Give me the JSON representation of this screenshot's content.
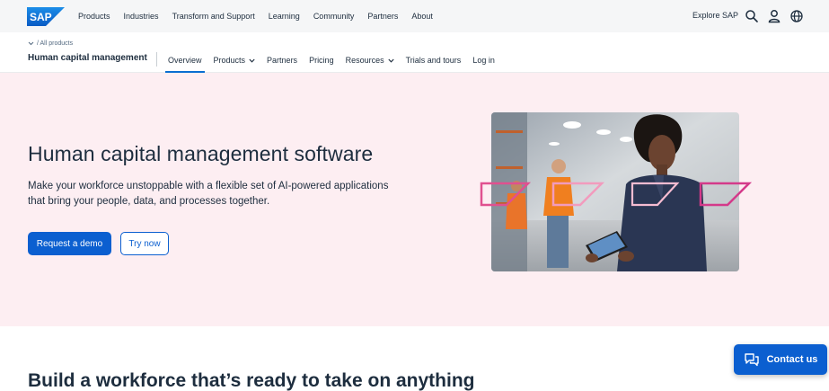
{
  "header": {
    "logo_text": "SAP",
    "nav": [
      "Products",
      "Industries",
      "Transform and Support",
      "Learning",
      "Community",
      "Partners",
      "About"
    ],
    "explore_label": "Explore SAP",
    "icons": [
      "search-icon",
      "user-icon",
      "globe-icon"
    ]
  },
  "subnav": {
    "breadcrumb": "/ All products",
    "section_title": "Human capital management",
    "items": [
      {
        "label": "Overview",
        "active": true
      },
      {
        "label": "Products",
        "dropdown": true
      },
      {
        "label": "Partners"
      },
      {
        "label": "Pricing"
      },
      {
        "label": "Resources",
        "dropdown": true
      },
      {
        "label": "Trials and tours"
      },
      {
        "label": "Log in"
      }
    ]
  },
  "hero": {
    "title": "Human capital management software",
    "description": "Make your workforce unstoppable with a flexible set of AI-powered applications that bring your people, data, and processes together.",
    "primary_cta": "Request a demo",
    "secondary_cta": "Try now"
  },
  "section2": {
    "title": "Build a workforce that’s ready to take on anything"
  },
  "contact": {
    "label": "Contact us"
  },
  "colors": {
    "brand_blue": "#0b5fd0",
    "hero_background": "#fdeef2",
    "accent_pink": "#e0508f",
    "text": "#1d2d3e"
  }
}
